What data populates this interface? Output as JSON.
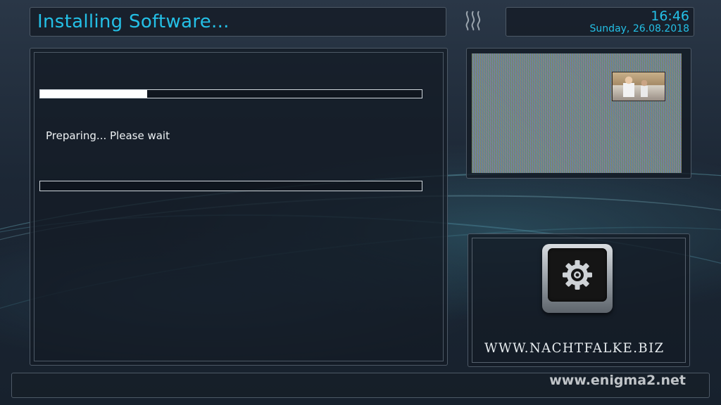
{
  "header": {
    "title": "Installing Software..."
  },
  "clock": {
    "time": "16:46",
    "date": "Sunday, 26.08.2018"
  },
  "install": {
    "status_text": "Preparing... Please wait",
    "progress_top_percent": 28,
    "progress_bottom_percent": 0
  },
  "branding": {
    "site_text": "WWW.NACHTFALKE.BIZ",
    "watermark": "www.enigma2.net"
  },
  "icons": {
    "logo": "wave-lines-icon",
    "settings": "gear-icon"
  },
  "colors": {
    "accent": "#24c0e6",
    "text": "#eef2f4"
  }
}
